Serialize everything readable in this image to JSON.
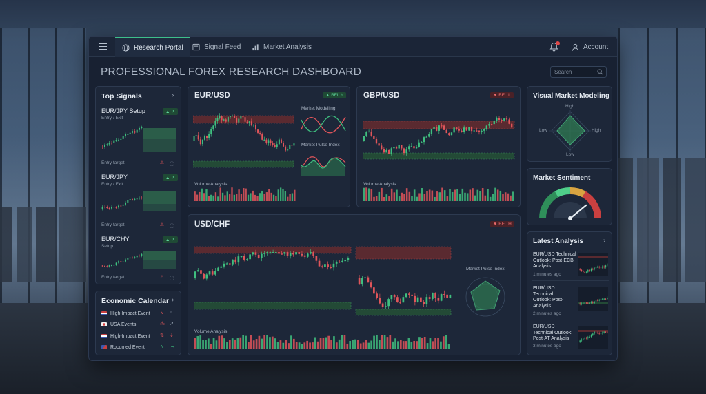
{
  "nav": {
    "tabs": [
      {
        "label": "Research Portal",
        "icon": "globe-icon",
        "active": true
      },
      {
        "label": "Signal Feed",
        "icon": "feed-icon",
        "active": false
      },
      {
        "label": "Market Analysis",
        "icon": "bar-chart-icon",
        "active": false
      }
    ],
    "account_label": "Account",
    "notification_dot": true
  },
  "page_title": "PROFESSIONAL FOREX RESEARCH DASHBOARD",
  "search": {
    "placeholder": "Search"
  },
  "top_signals": {
    "title": "Top Signals",
    "items": [
      {
        "pair": "EUR/JPY Setup",
        "sub": "Entry / Exit",
        "footer": "Entry target"
      },
      {
        "pair": "EUR/JPY",
        "sub": "Entry / Exit",
        "footer": "Entry target"
      },
      {
        "pair": "EUR/CHY",
        "sub": "Setup",
        "footer": "Entry target"
      }
    ]
  },
  "economic_calendar": {
    "title": "Economic Calendar",
    "rows": [
      {
        "label": "High-Impact Event"
      },
      {
        "label": "USA Events"
      },
      {
        "label": "High-Impact Event"
      },
      {
        "label": "Rocomed Event"
      }
    ]
  },
  "charts": {
    "eurusd": {
      "title": "EUR/USD",
      "badge": "BEL h",
      "direction": "up",
      "side_title_1": "Market Modelling",
      "side_title_2": "Market Pulse Index",
      "volume_label": "Volume Analysis"
    },
    "gbpusd": {
      "title": "GBP/USD",
      "badge": "BEL L",
      "direction": "down",
      "volume_label": "Volume Analysis"
    },
    "usdchf": {
      "title": "USD/CHF",
      "badge": "BEL H",
      "direction": "down",
      "side_title": "Market Pulse Index",
      "volume_label": "Volume Analysis"
    }
  },
  "visual_modeling": {
    "title": "Visual Market Modeling",
    "labels": {
      "top": "High",
      "left": "Low",
      "right": "High",
      "bottom": "Low"
    }
  },
  "market_sentiment": {
    "title": "Market Sentiment",
    "needle_fraction": 0.78
  },
  "latest_analysis": {
    "title": "Latest Analysis",
    "items": [
      {
        "title": "EUR/USD Technical Outlook: Post-ECB Analysis",
        "time": "1 minutes ago"
      },
      {
        "title": "EUR/USD Technical Outlook: Post-Analysis",
        "time": "2 minutes ago"
      },
      {
        "title": "EUR/USD Technical Outlook: Post-AT Analysis",
        "time": "3 minutes ago"
      }
    ]
  },
  "colors": {
    "up": "#3fbf7f",
    "down": "#e0555a",
    "accent": "#3dbf8a",
    "panel": "#1d2739"
  }
}
